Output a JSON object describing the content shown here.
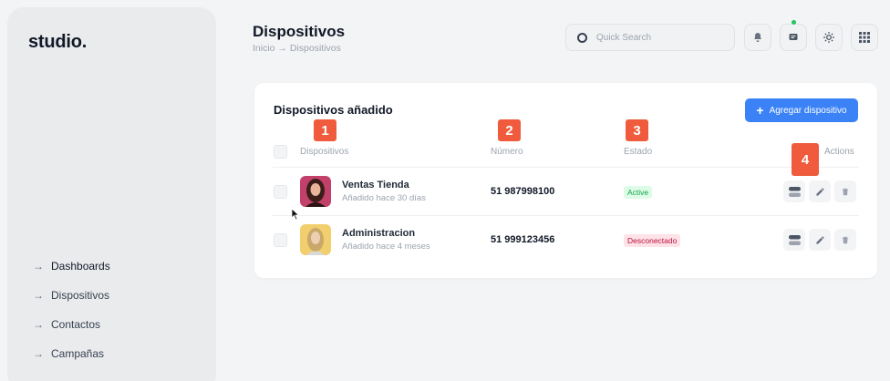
{
  "app": {
    "logo": "studio."
  },
  "sidebar": {
    "items": [
      {
        "label": "Dashboards"
      },
      {
        "label": "Dispositivos"
      },
      {
        "label": "Contactos"
      },
      {
        "label": "Campañas"
      }
    ]
  },
  "header": {
    "title": "Dispositivos",
    "breadcrumb": "Inicio → Dispositivos",
    "search_placeholder": "Quick Search",
    "icons": [
      "bell-icon",
      "chat-icon",
      "sun-icon",
      "grid-icon"
    ],
    "notification_color": "#22c55e"
  },
  "card": {
    "title": "Dispositivos añadido",
    "add_button_label": "Agregar dispositivo",
    "add_button_color": "#3b82f6",
    "columns": {
      "devices": "Dispositivos",
      "number": "Número",
      "status": "Estado",
      "actions": "Actions"
    },
    "rows": [
      {
        "name": "Ventas Tienda",
        "sub": "Añadido hace 30 días",
        "number": "51 987998100",
        "status": "Active",
        "status_color": "#16a34a"
      },
      {
        "name": "Administracion",
        "sub": "Añadido hace 4 meses",
        "number": "51 999123456",
        "status": "Desconectado",
        "status_color": "#be123c"
      }
    ]
  },
  "markers": [
    "1",
    "2",
    "3",
    "4"
  ],
  "marker_color": "#ef5b3c"
}
